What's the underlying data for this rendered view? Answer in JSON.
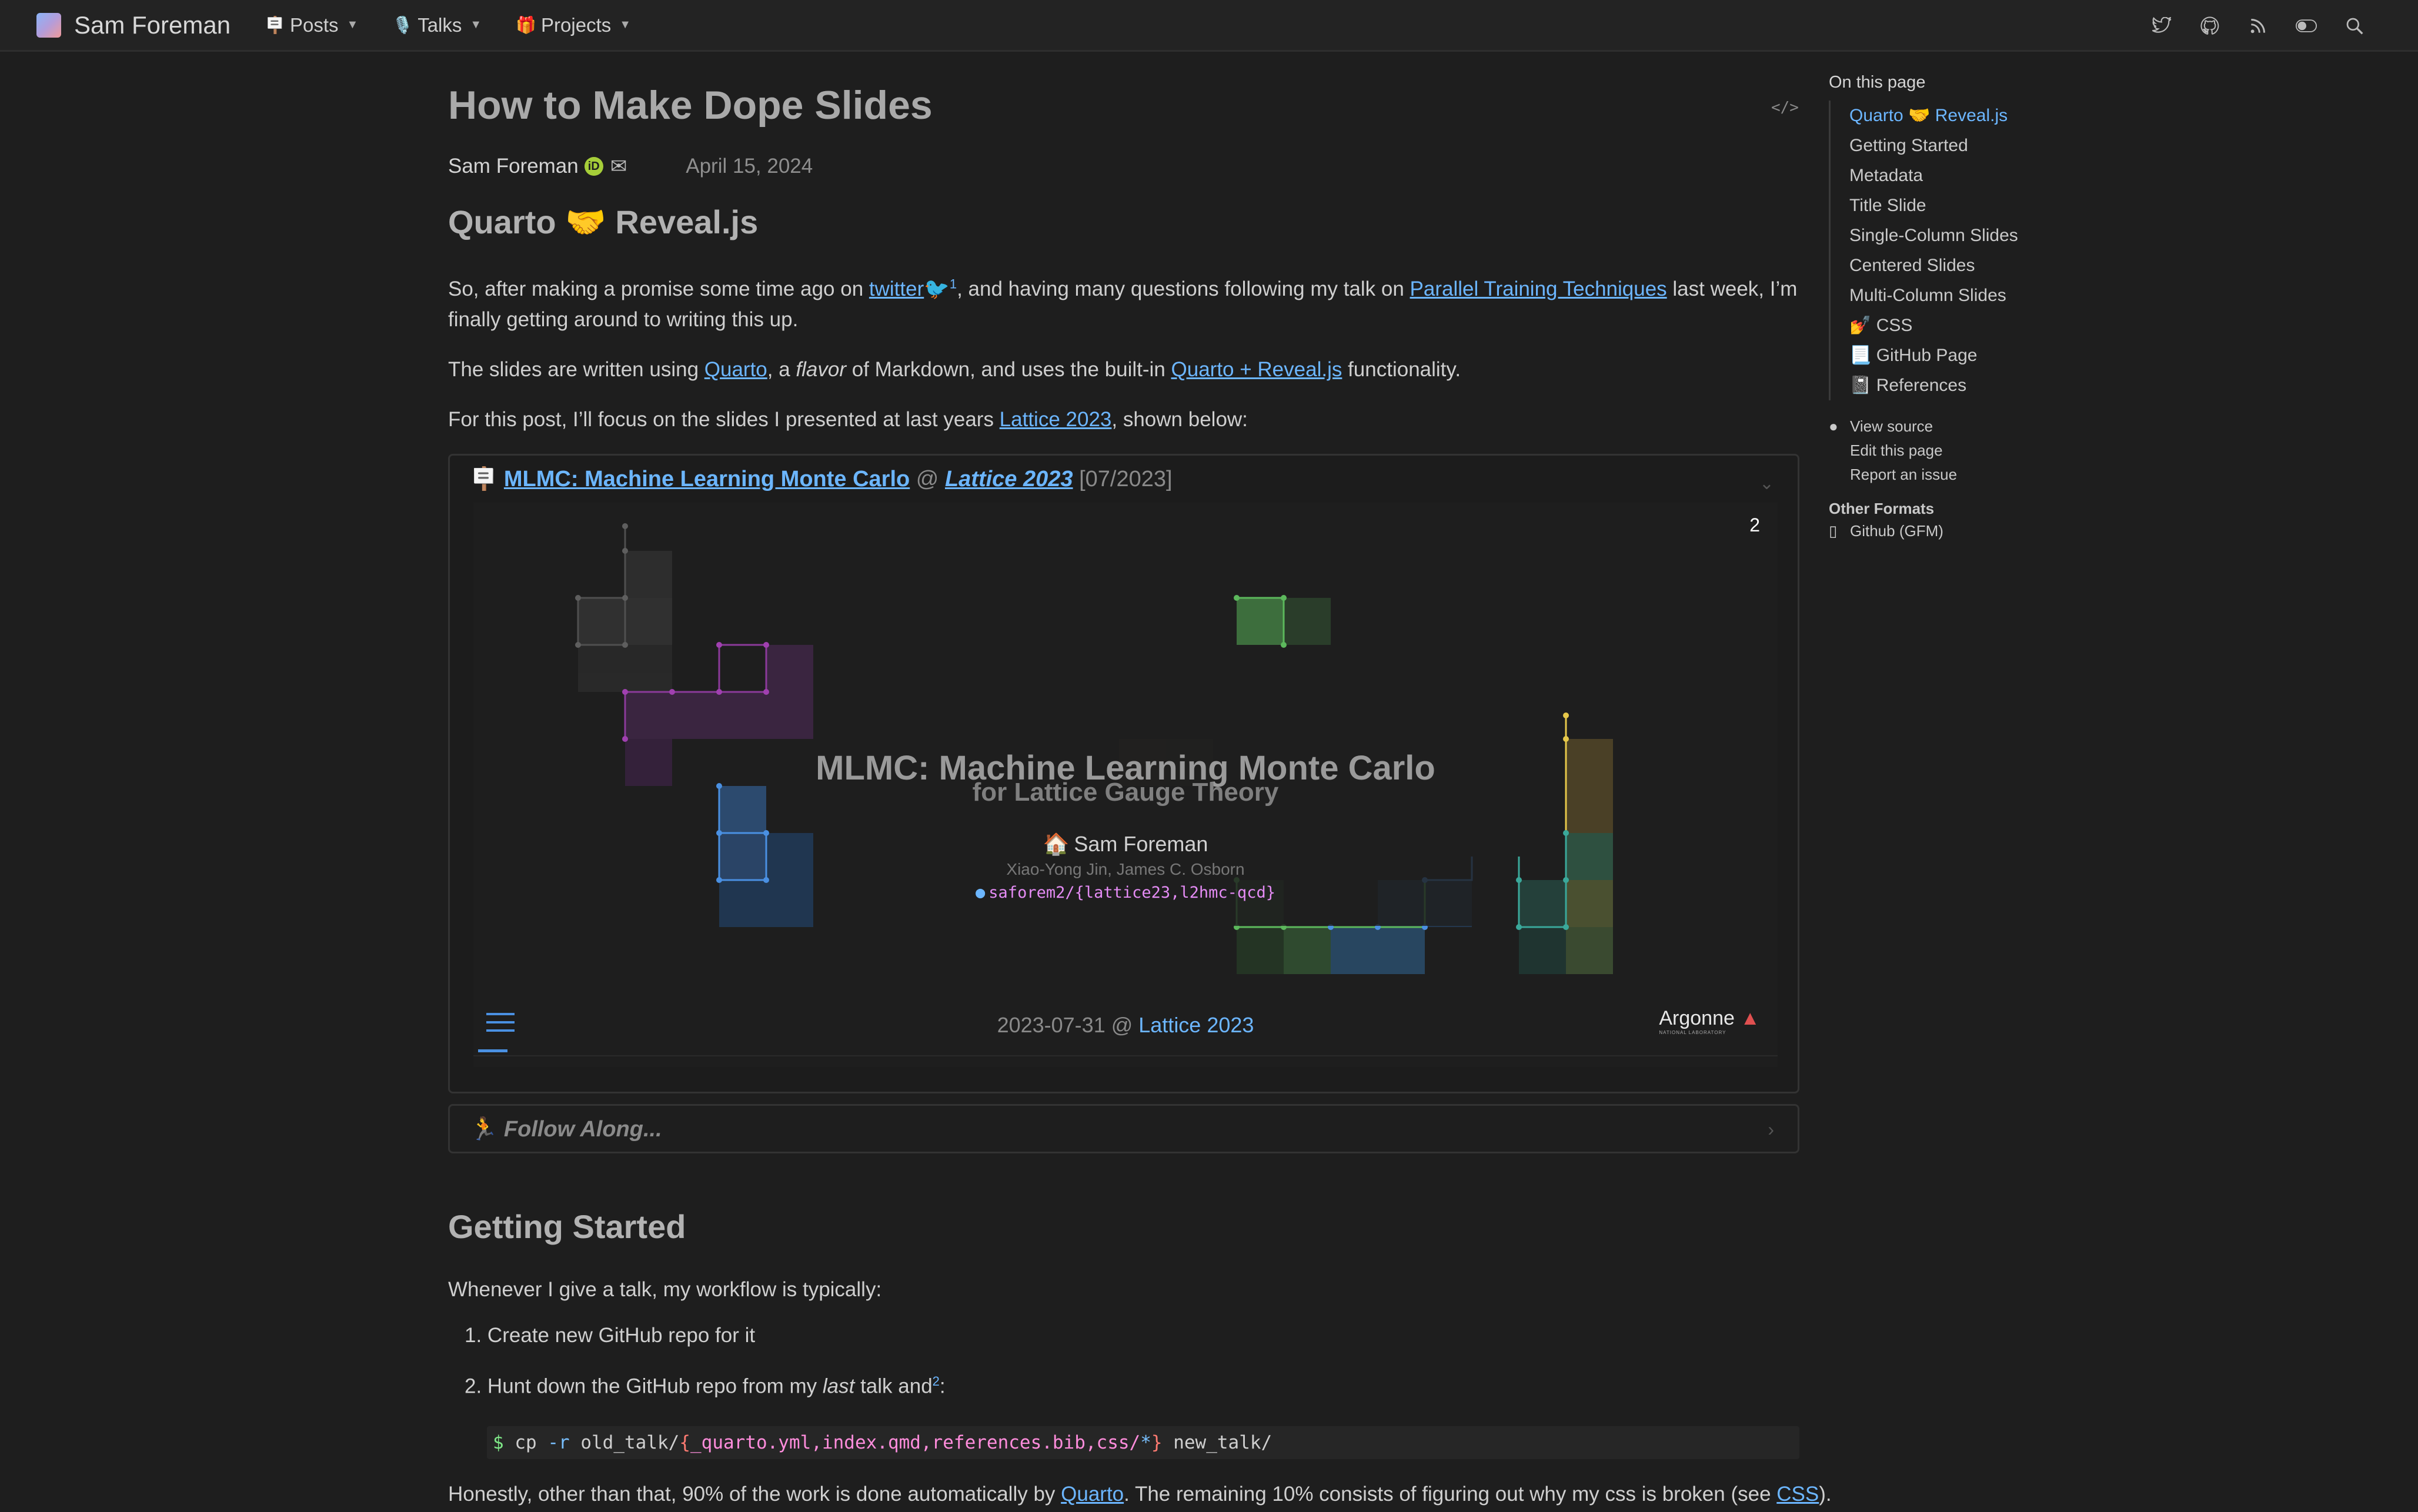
{
  "nav": {
    "brand": "Sam Foreman",
    "items": [
      {
        "emoji": "🪧",
        "label": "Posts"
      },
      {
        "emoji": "🎙️",
        "label": "Talks"
      },
      {
        "emoji": "🎁",
        "label": "Projects"
      }
    ],
    "icons": [
      "twitter-icon",
      "github-icon",
      "rss-icon",
      "theme-toggle-icon",
      "search-icon"
    ]
  },
  "post": {
    "title": "How to Make Dope Slides",
    "author": "Sam Foreman",
    "orcid": "iD",
    "date": "April 15, 2024",
    "code_toggle": "</>"
  },
  "section1": {
    "heading": "Quarto 🤝 Reveal.js",
    "p1": {
      "a": "So, after making a promise some time ago on ",
      "twitter": "twitter",
      "sup": "1",
      "b": ", and having many questions following my talk on ",
      "talk_link": "Parallel Training Techniques",
      "c": " last week, I’m",
      "d": "finally getting around to writing this up."
    },
    "p2": {
      "a": "The slides are written using ",
      "quarto": "Quarto",
      "b": ", a ",
      "flavor": "flavor",
      "c": " of Markdown, and uses the built-in ",
      "reveal": "Quarto + Reveal.js",
      "d": " functionality."
    },
    "p3": {
      "a": "For this post, I’ll focus on the slides I presented at last years ",
      "lattice": "Lattice 2023",
      "b": ", shown below:"
    }
  },
  "embed": {
    "emoji": "🪧",
    "title_link": "MLMC: Machine Learning Monte Carlo",
    "at": " @ ",
    "venue": "Lattice 2023",
    "date": "[07/2023]",
    "slide": {
      "number": "2",
      "title": "MLMC: Machine Learning Monte Carlo",
      "subtitle": "for Lattice Gauge Theory",
      "author": "Sam Foreman",
      "coauthors": "Xiao-Yong Jin, James C. Osborn",
      "repo": "saforem2/{lattice23,l2hmc-qcd}",
      "footer_date": "2023-07-31 @ ",
      "footer_link": "Lattice 2023",
      "logo": "Argonne",
      "logo_sub": "NATIONAL LABORATORY"
    }
  },
  "follow": {
    "emoji": "🏃",
    "label": "Follow Along..."
  },
  "section2": {
    "heading": "Getting Started",
    "intro": "Whenever I give a talk, my workflow is typically:",
    "step1": "Create new GitHub repo for it",
    "step2_a": "Hunt down the GitHub repo from my ",
    "step2_em": "last",
    "step2_b": " talk and",
    "step2_sup": "2",
    "step2_c": ":",
    "code": {
      "prompt": "$",
      "cmd": "cp",
      "flag": "-r",
      "src": "old_talk/",
      "brace_open": "{",
      "files": "_quarto.yml,index.qmd,references.bib,css/",
      "star": "*",
      "brace_close": "}",
      "dest": "new_talk/"
    },
    "outro_a": "Honestly, other than that, 90% of the work is done automatically by ",
    "outro_quarto": "Quarto",
    "outro_b": ". The remaining 10% consists of figuring out why my css is broken (see ",
    "outro_css": "CSS",
    "outro_c": ")."
  },
  "toc": {
    "title": "On this page",
    "items": [
      "Quarto 🤝 Reveal.js",
      "Getting Started",
      "Metadata",
      "Title Slide",
      "Single-Column Slides",
      "Centered Slides",
      "Multi-Column Slides",
      "💅 CSS",
      "📃 GitHub Page",
      "📓 References"
    ],
    "links": [
      "View source",
      "Edit this page",
      "Report an issue"
    ],
    "other_title": "Other Formats",
    "other_items": [
      "Github (GFM)"
    ]
  },
  "colors": {
    "background": "#1e1e1e",
    "link": "#6cb6ff",
    "nav_bg": "#232323"
  }
}
